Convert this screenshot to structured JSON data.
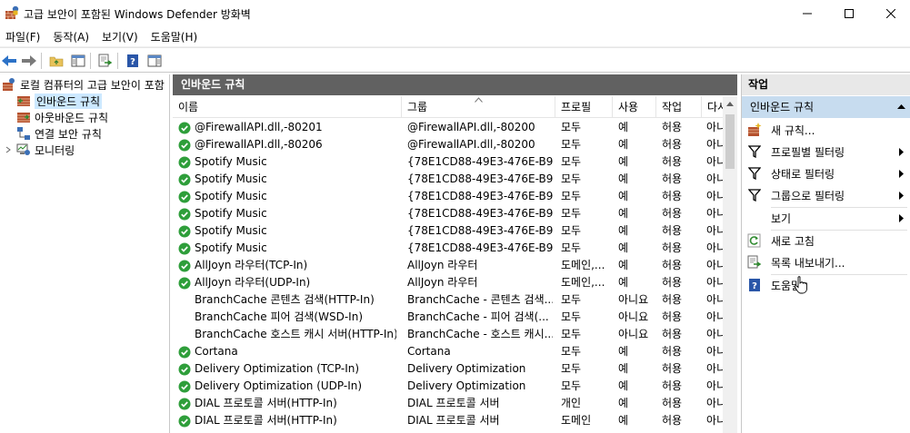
{
  "window": {
    "title": "고급 보안이 포함된 Windows Defender 방화벽"
  },
  "menu": [
    "파일(F)",
    "동작(A)",
    "보기(V)",
    "도움말(H)"
  ],
  "tree": {
    "root": "로컬 컴퓨터의 고급 보안이 포함",
    "items": [
      "인바운드 규칙",
      "아웃바운드 규칙",
      "연결 보안 규칙",
      "모니터링"
    ]
  },
  "center": {
    "title": "인바운드 규칙",
    "columns": [
      "이름",
      "그룹",
      "프로필",
      "사용",
      "작업",
      "다시"
    ],
    "rows": [
      {
        "name": "@FirewallAPI.dll,-80201",
        "group": "@FirewallAPI.dll,-80200",
        "profile": "모두",
        "enabled": "예",
        "action": "허용",
        "over": "아니",
        "checked": true
      },
      {
        "name": "@FirewallAPI.dll,-80206",
        "group": "@FirewallAPI.dll,-80200",
        "profile": "모두",
        "enabled": "예",
        "action": "허용",
        "over": "아니",
        "checked": true
      },
      {
        "name": "Spotify Music",
        "group": "{78E1CD88-49E3-476E-B9...",
        "profile": "모두",
        "enabled": "예",
        "action": "허용",
        "over": "아니",
        "checked": true
      },
      {
        "name": "Spotify Music",
        "group": "{78E1CD88-49E3-476E-B9...",
        "profile": "모두",
        "enabled": "예",
        "action": "허용",
        "over": "아니",
        "checked": true
      },
      {
        "name": "Spotify Music",
        "group": "{78E1CD88-49E3-476E-B9...",
        "profile": "모두",
        "enabled": "예",
        "action": "허용",
        "over": "아니",
        "checked": true
      },
      {
        "name": "Spotify Music",
        "group": "{78E1CD88-49E3-476E-B9...",
        "profile": "모두",
        "enabled": "예",
        "action": "허용",
        "over": "아니",
        "checked": true
      },
      {
        "name": "Spotify Music",
        "group": "{78E1CD88-49E3-476E-B9...",
        "profile": "모두",
        "enabled": "예",
        "action": "허용",
        "over": "아니",
        "checked": true
      },
      {
        "name": "Spotify Music",
        "group": "{78E1CD88-49E3-476E-B9...",
        "profile": "모두",
        "enabled": "예",
        "action": "허용",
        "over": "아니",
        "checked": true
      },
      {
        "name": "AllJoyn 라우터(TCP-In)",
        "group": "AllJoyn 라우터",
        "profile": "도메인,...",
        "enabled": "예",
        "action": "허용",
        "over": "아니",
        "checked": true
      },
      {
        "name": "AllJoyn 라우터(UDP-In)",
        "group": "AllJoyn 라우터",
        "profile": "도메인,...",
        "enabled": "예",
        "action": "허용",
        "over": "아니",
        "checked": true
      },
      {
        "name": "BranchCache 콘텐츠 검색(HTTP-In)",
        "group": "BranchCache - 콘텐츠 검색...",
        "profile": "모두",
        "enabled": "아니요",
        "action": "허용",
        "over": "아니",
        "checked": false
      },
      {
        "name": "BranchCache 피어 검색(WSD-In)",
        "group": "BranchCache - 피어 검색(...",
        "profile": "모두",
        "enabled": "아니요",
        "action": "허용",
        "over": "아니",
        "checked": false
      },
      {
        "name": "BranchCache 호스트 캐시 서버(HTTP-In)",
        "group": "BranchCache - 호스트 캐시...",
        "profile": "모두",
        "enabled": "아니요",
        "action": "허용",
        "over": "아니",
        "checked": false
      },
      {
        "name": "Cortana",
        "group": "Cortana",
        "profile": "모두",
        "enabled": "예",
        "action": "허용",
        "over": "아니",
        "checked": true
      },
      {
        "name": "Delivery Optimization (TCP-In)",
        "group": "Delivery Optimization",
        "profile": "모두",
        "enabled": "예",
        "action": "허용",
        "over": "아니",
        "checked": true
      },
      {
        "name": "Delivery Optimization (UDP-In)",
        "group": "Delivery Optimization",
        "profile": "모두",
        "enabled": "예",
        "action": "허용",
        "over": "아니",
        "checked": true
      },
      {
        "name": "DIAL 프로토콜 서버(HTTP-In)",
        "group": "DIAL 프로토콜 서버",
        "profile": "개인",
        "enabled": "예",
        "action": "허용",
        "over": "아니",
        "checked": true
      },
      {
        "name": "DIAL 프로토콜 서버(HTTP-In)",
        "group": "DIAL 프로토콜 서버",
        "profile": "도메인",
        "enabled": "예",
        "action": "허용",
        "over": "아니",
        "checked": true
      }
    ]
  },
  "actions": {
    "title": "작업",
    "section": "인바운드 규칙",
    "items": [
      "새 규칙...",
      "프로필별 필터링",
      "상태로 필터링",
      "그룹으로 필터링",
      "보기",
      "새로 고침",
      "목록 내보내기...",
      "도움말"
    ]
  },
  "colors": {
    "pane_header": "#616161",
    "selected_section": "#c7dcef",
    "check_green": "#2e9e3a"
  }
}
